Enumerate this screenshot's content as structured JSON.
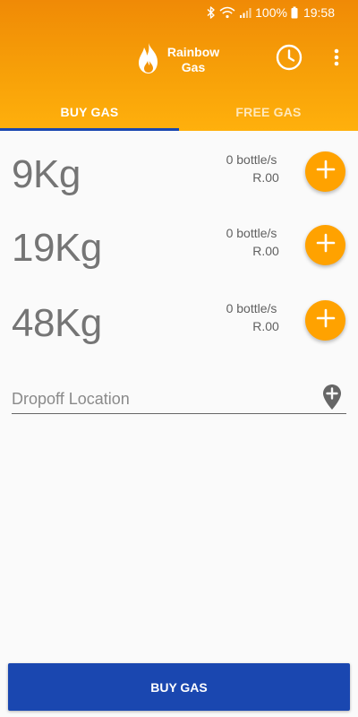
{
  "status_bar": {
    "battery": "100%",
    "time": "19:58"
  },
  "app_bar": {
    "title_line1": "Rainbow",
    "title_line2": "Gas",
    "icons": [
      "flame-logo-icon",
      "history-clock-icon",
      "more-vert-icon"
    ]
  },
  "tabs": [
    {
      "label": "BUY GAS",
      "selected": true
    },
    {
      "label": "FREE GAS",
      "selected": false
    }
  ],
  "products": [
    {
      "weight": "9Kg",
      "quantity": "0 bottle/s",
      "price": "R.00"
    },
    {
      "weight": "19Kg",
      "quantity": "0 bottle/s",
      "price": "R.00"
    },
    {
      "weight": "48Kg",
      "quantity": "0 bottle/s",
      "price": "R.00"
    }
  ],
  "dropoff": {
    "placeholder": "Dropoff Location",
    "value": ""
  },
  "buy_button": {
    "label": "BUY GAS"
  },
  "colors": {
    "accent": "#ffa200",
    "appbar_top": "#f08a06",
    "primary_blue": "#1a47b0",
    "background": "#fafafa"
  }
}
